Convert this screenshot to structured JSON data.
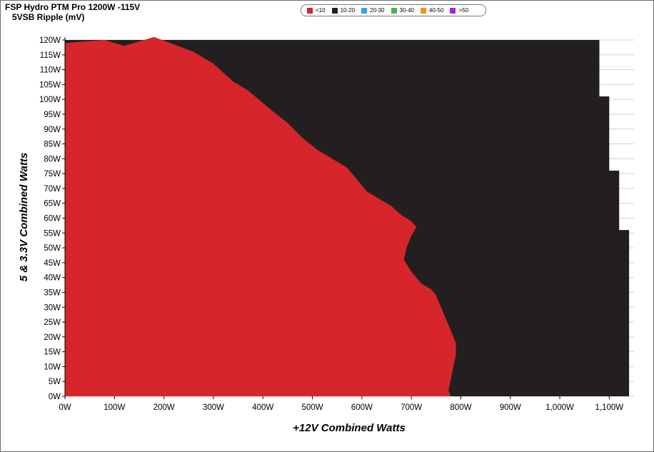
{
  "chart_data": {
    "type": "heatmap",
    "title": "FSP Hydro PTM Pro 1200W -115V",
    "subtitle": "5VSB Ripple (mV)",
    "xlabel": "+12V Combined Watts",
    "ylabel": "5 & 3.3V Combined Watts",
    "x_ticks": [
      "0W",
      "100W",
      "200W",
      "300W",
      "400W",
      "500W",
      "600W",
      "700W",
      "800W",
      "900W",
      "1,000W",
      "1,100W"
    ],
    "y_ticks": [
      "0W",
      "5W",
      "10W",
      "15W",
      "20W",
      "25W",
      "30W",
      "35W",
      "40W",
      "45W",
      "50W",
      "55W",
      "60W",
      "65W",
      "70W",
      "75W",
      "80W",
      "85W",
      "90W",
      "95W",
      "100W",
      "105W",
      "110W",
      "115W",
      "120W"
    ],
    "xlim": [
      0,
      1150
    ],
    "ylim": [
      0,
      120
    ],
    "legend": {
      "position": "top",
      "items": [
        {
          "label": "<10",
          "color": "#d7262b"
        },
        {
          "label": "10-20",
          "color": "#231f20"
        },
        {
          "label": "20-30",
          "color": "#2aa7e0"
        },
        {
          "label": "30-40",
          "color": "#4fb050"
        },
        {
          "label": "40-50",
          "color": "#f39322"
        },
        {
          "label": ">50",
          "color": "#a024e0"
        }
      ]
    },
    "load_limit": [
      [
        0,
        120
      ],
      [
        1080,
        120
      ],
      [
        1080,
        101
      ],
      [
        1100,
        101
      ],
      [
        1100,
        76
      ],
      [
        1120,
        76
      ],
      [
        1120,
        56
      ],
      [
        1140,
        56
      ],
      [
        1140,
        0
      ],
      [
        0,
        0
      ]
    ],
    "boundary_10mV": [
      [
        1,
        119
      ],
      [
        80,
        120
      ],
      [
        120,
        118
      ],
      [
        180,
        121
      ],
      [
        260,
        116
      ],
      [
        300,
        112
      ],
      [
        340,
        106
      ],
      [
        370,
        103
      ],
      [
        420,
        96
      ],
      [
        450,
        92
      ],
      [
        480,
        87
      ],
      [
        510,
        83
      ],
      [
        540,
        80
      ],
      [
        570,
        77
      ],
      [
        590,
        73
      ],
      [
        610,
        69
      ],
      [
        640,
        66
      ],
      [
        660,
        64
      ],
      [
        680,
        61
      ],
      [
        700,
        59
      ],
      [
        710,
        57
      ],
      [
        700,
        54
      ],
      [
        690,
        50
      ],
      [
        685,
        46
      ],
      [
        700,
        42
      ],
      [
        720,
        38
      ],
      [
        740,
        36
      ],
      [
        750,
        34
      ],
      [
        760,
        30
      ],
      [
        770,
        26
      ],
      [
        780,
        22
      ],
      [
        790,
        18
      ],
      [
        790,
        14
      ],
      [
        785,
        10
      ],
      [
        780,
        6
      ],
      [
        775,
        2
      ],
      [
        780,
        0
      ]
    ],
    "grid": true
  }
}
